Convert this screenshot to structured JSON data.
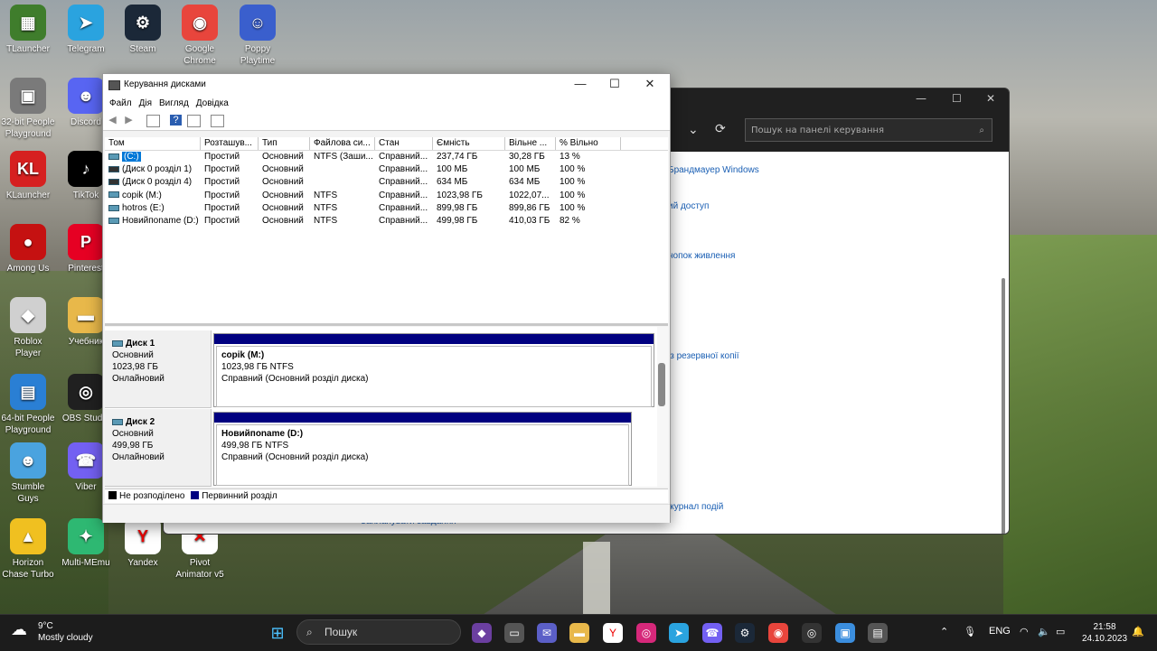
{
  "desktop": {
    "icons": [
      {
        "label": "TLauncher",
        "color": "#3f7d2c",
        "glyph": "▦"
      },
      {
        "label": "Telegram",
        "color": "#2aa3df",
        "glyph": "➤"
      },
      {
        "label": "Steam",
        "color": "#1b2838",
        "glyph": "⚙"
      },
      {
        "label": "Google Chrome",
        "color": "#e8453c",
        "glyph": "◉"
      },
      {
        "label": "Poppy Playtime",
        "color": "#3a5fcd",
        "glyph": "☺"
      },
      {
        "label": "32-bit People Playground",
        "color": "#7a7a7a",
        "glyph": "▣"
      },
      {
        "label": "Discord",
        "color": "#5865f2",
        "glyph": "☻"
      },
      {
        "label": "KLauncher",
        "color": "#d62020",
        "glyph": "KL"
      },
      {
        "label": "TikTok",
        "color": "#000000",
        "glyph": "♪"
      },
      {
        "label": "Among Us",
        "color": "#c51111",
        "glyph": "●"
      },
      {
        "label": "Pinterest",
        "color": "#e60023",
        "glyph": "P"
      },
      {
        "label": "Roblox Player",
        "color": "#d0d0d0",
        "glyph": "◆"
      },
      {
        "label": "Учебник",
        "color": "#e8b84a",
        "glyph": "▬"
      },
      {
        "label": "64-bit People Playground",
        "color": "#2a7fd4",
        "glyph": "▤"
      },
      {
        "label": "OBS Studio",
        "color": "#202020",
        "glyph": "◎"
      },
      {
        "label": "Stumble Guys",
        "color": "#4aa3df",
        "glyph": "☻"
      },
      {
        "label": "Viber",
        "color": "#7360f2",
        "glyph": "☎"
      },
      {
        "label": "Horizon Chase Turbo",
        "color": "#f0c020",
        "glyph": "▲"
      },
      {
        "label": "Multi-MEmu",
        "color": "#2eb872",
        "glyph": "✦"
      },
      {
        "label": "Yandex",
        "color": "#ffffff",
        "glyph": "Y"
      },
      {
        "label": "Pivot Animator v5",
        "color": "#ffffff",
        "glyph": "✕"
      }
    ]
  },
  "control_panel": {
    "search_placeholder": "Пошук на панелі керування",
    "links": [
      "Брандмауер Windows",
      "ий доступ",
      "нопок живлення",
      "із резервної копії",
      "журнал подій"
    ],
    "bottom_link": "Запланувати завдання"
  },
  "disk_mgmt": {
    "title": "Керування дисками",
    "menu": [
      "Файл",
      "Дія",
      "Вигляд",
      "Довідка"
    ],
    "columns": [
      "Том",
      "Розташув...",
      "Тип",
      "Файлова си...",
      "Стан",
      "Ємність",
      "Вільне ...",
      "% Вільно"
    ],
    "volumes": [
      [
        "(C:)",
        "Простий",
        "Основний",
        "NTFS (Заши...",
        "Справний...",
        "237,74 ГБ",
        "30,28 ГБ",
        "13 %"
      ],
      [
        "(Диск 0 розділ 1)",
        "Простий",
        "Основний",
        "",
        "Справний...",
        "100 МБ",
        "100 МБ",
        "100 %"
      ],
      [
        "(Диск 0 розділ 4)",
        "Простий",
        "Основний",
        "",
        "Справний...",
        "634 МБ",
        "634 МБ",
        "100 %"
      ],
      [
        "copik (M:)",
        "Простий",
        "Основний",
        "NTFS",
        "Справний...",
        "1023,98 ГБ",
        "1022,07...",
        "100 %"
      ],
      [
        "hotros (E:)",
        "Простий",
        "Основний",
        "NTFS",
        "Справний...",
        "899,98 ГБ",
        "899,86 ГБ",
        "100 %"
      ],
      [
        "Новийпоname (D:)",
        "Простий",
        "Основний",
        "NTFS",
        "Справний...",
        "499,98 ГБ",
        "410,03 ГБ",
        "82 %"
      ]
    ],
    "disks": [
      {
        "name": "Диск 1",
        "kind": "Основний",
        "size": "1023,98 ГБ",
        "state": "Онлайновий",
        "part_name": "copik  (M:)",
        "part_size": "1023,98 ГБ NTFS",
        "part_state": "Справний (Основний розділ диска)"
      },
      {
        "name": "Диск 2",
        "kind": "Основний",
        "size": "499,98 ГБ",
        "state": "Онлайновий",
        "part_name": "Новийпоname  (D:)",
        "part_size": "499,98 ГБ NTFS",
        "part_state": "Справний (Основний розділ диска)"
      }
    ],
    "legend": [
      {
        "label": "Не розподілено",
        "color": "#000000"
      },
      {
        "label": "Первинний розділ",
        "color": "#000080"
      }
    ]
  },
  "taskbar": {
    "temp": "9°C",
    "weather": "Mostly cloudy",
    "search": "Пошук",
    "lang": "ENG",
    "time": "21:58",
    "date": "24.10.2023"
  }
}
